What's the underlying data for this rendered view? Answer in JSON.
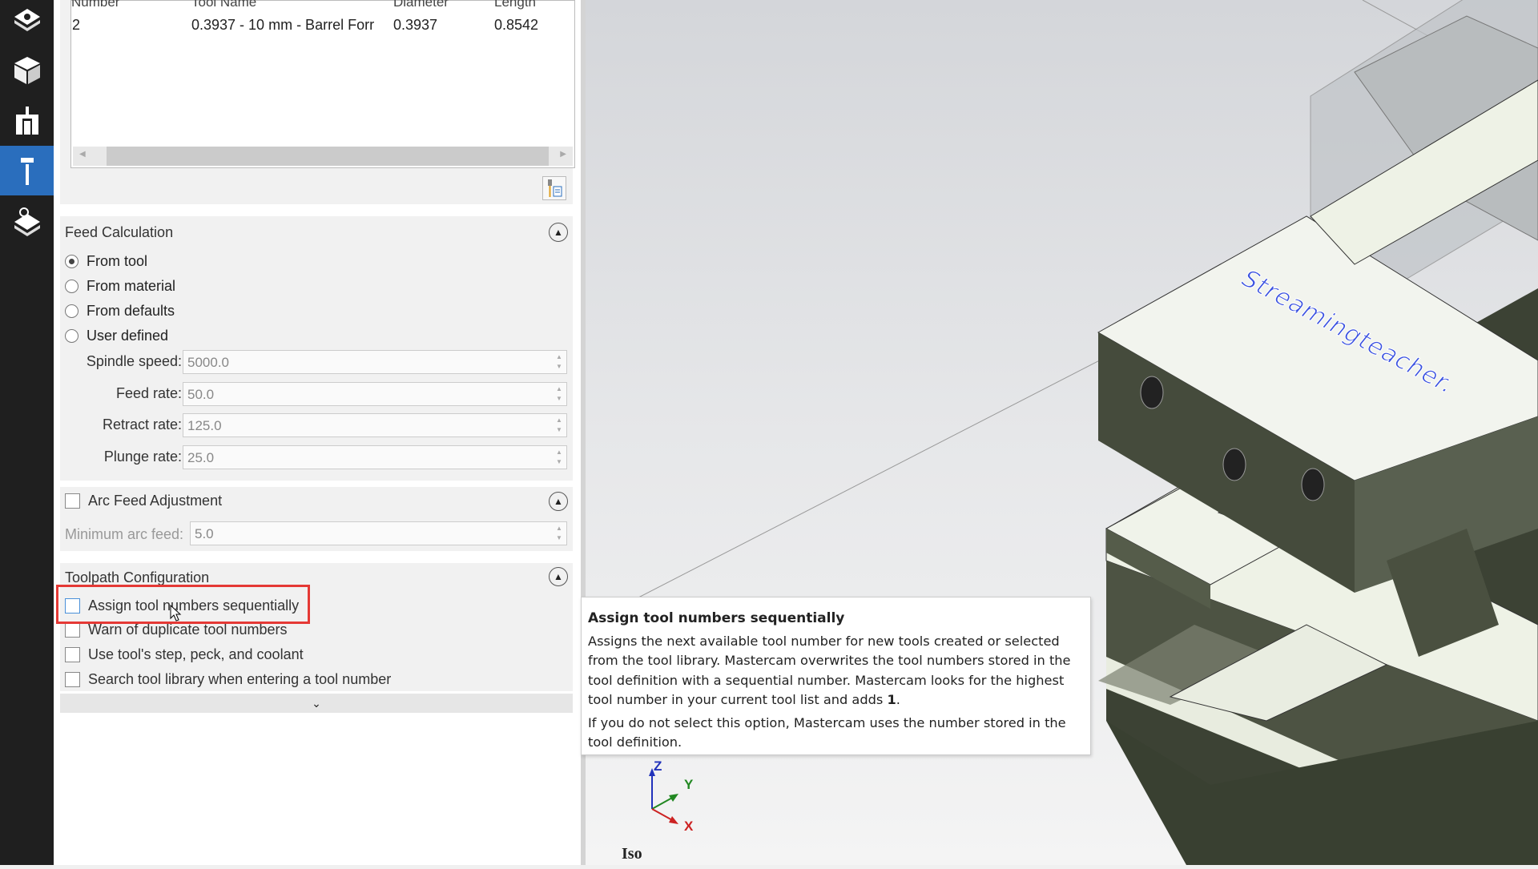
{
  "sidebar": {
    "icons": [
      "toolpaths-icon",
      "solids-icon",
      "planes-icon",
      "toolpath-tool-icon",
      "stock-icon"
    ],
    "active": 3,
    "accent": "#2a6ebd"
  },
  "tool_table": {
    "columns": [
      "Number",
      "Tool Name",
      "Diameter",
      "Length"
    ],
    "rows": [
      [
        "2",
        "0.3937 - 10 mm - Barrel Forr",
        "0.3937",
        "0.8542"
      ]
    ]
  },
  "feed": {
    "title": "Feed Calculation",
    "options": [
      "From tool",
      "From material",
      "From defaults",
      "User defined"
    ],
    "selected": 0,
    "fields": [
      {
        "label": "Spindle speed:",
        "value": "5000.0"
      },
      {
        "label": "Feed rate:",
        "value": "50.0"
      },
      {
        "label": "Retract rate:",
        "value": "125.0"
      },
      {
        "label": "Plunge rate:",
        "value": "25.0"
      }
    ]
  },
  "arc": {
    "title": "Arc Feed Adjustment",
    "min_label": "Minimum arc feed:",
    "min_value": "5.0"
  },
  "config": {
    "title": "Toolpath Configuration",
    "options": [
      "Assign tool numbers sequentially",
      "Warn of duplicate tool numbers",
      "Use tool's step, peck, and coolant",
      "Search tool library when entering a tool number"
    ],
    "highlight_color": "#e53935"
  },
  "tooltip": {
    "title": "Assign tool numbers sequentially",
    "p1": "Assigns the next available tool number for new tools created or selected from the tool library. Mastercam overwrites the tool numbers stored in the tool definition with a sequential number. Mastercam looks for the highest tool number in your current tool list and adds ",
    "p1_bold": "1",
    "p1_end": ".",
    "p2": "If you do not select this option, Mastercam uses the number stored in the tool definition."
  },
  "viewport": {
    "watermark": "Streamingteacher.",
    "axes": {
      "z": "Z",
      "y": "Y",
      "x": "X"
    },
    "view": "Iso"
  }
}
